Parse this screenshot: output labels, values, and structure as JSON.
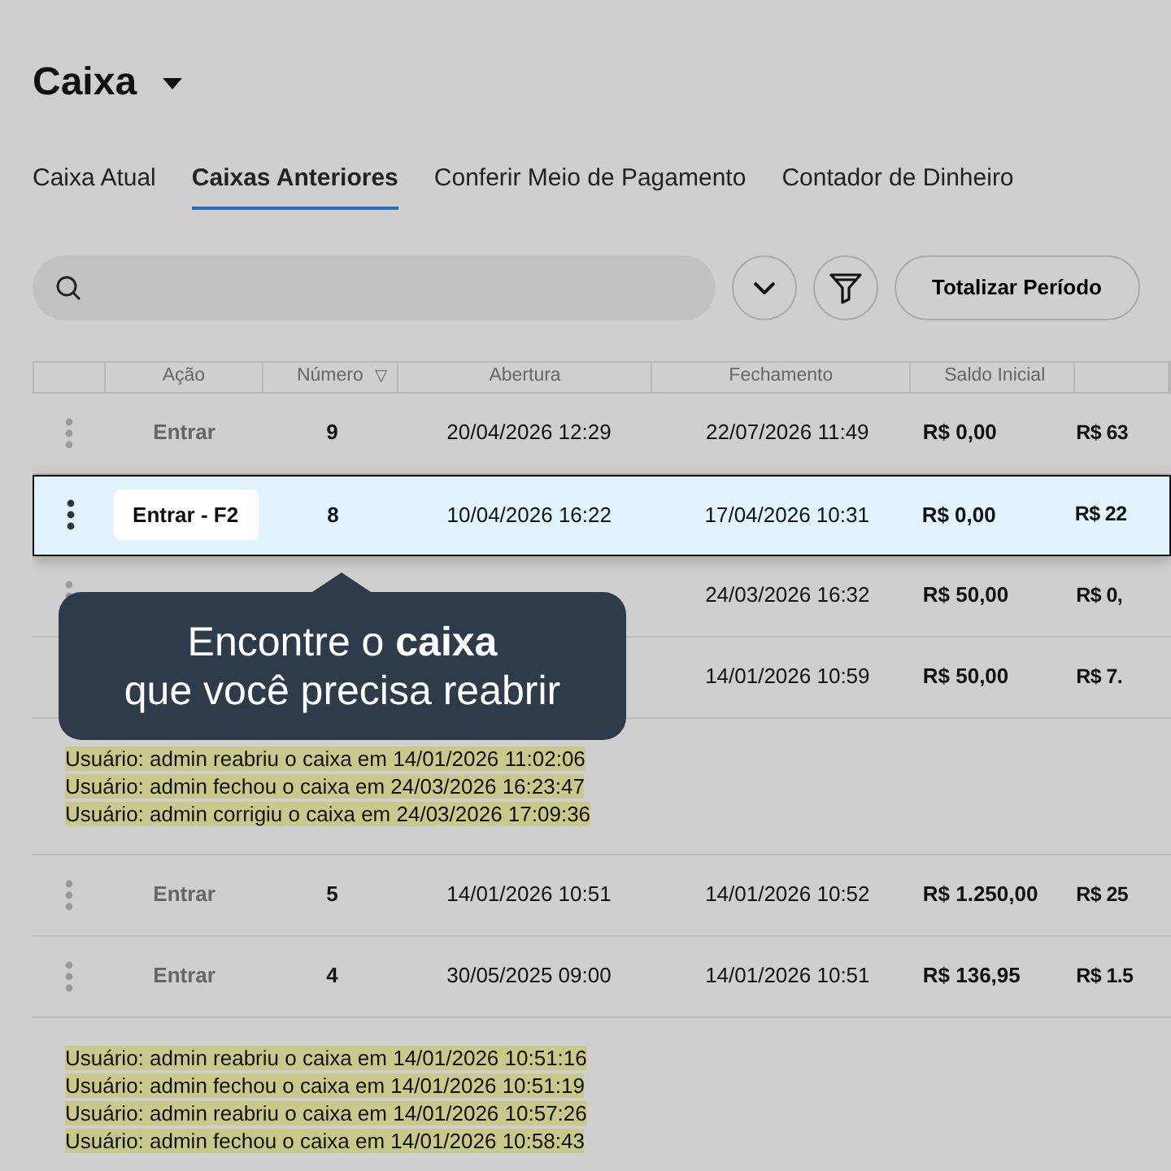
{
  "title": "Caixa",
  "tabs": [
    {
      "label": "Caixa Atual",
      "selected": false
    },
    {
      "label": "Caixas Anteriores",
      "selected": true
    },
    {
      "label": "Conferir Meio de Pagamento",
      "selected": false
    },
    {
      "label": "Contador de Dinheiro",
      "selected": false
    }
  ],
  "toolbar": {
    "button": "Totalizar Período"
  },
  "table": {
    "columns": [
      {},
      {
        "label": "Ação"
      },
      {
        "label": "Número",
        "sort_icon": "▽"
      },
      {
        "label": "Abertura"
      },
      {
        "label": "Fechamento"
      },
      {
        "label": "Saldo Inicial"
      },
      {}
    ],
    "rows": [
      {
        "kind": "row",
        "selected": false,
        "action": "Entrar",
        "number": "9",
        "opening": "20/04/2026 12:29",
        "closing": "22/07/2026 11:49",
        "initial_balance": "R$ 0,00",
        "column_7": "R$ 63"
      },
      {
        "kind": "row",
        "selected": true,
        "action": "Entrar - F2",
        "number": "8",
        "opening": "10/04/2026 16:22",
        "closing": "17/04/2026 10:31",
        "initial_balance": "R$ 0,00",
        "column_7": "R$ 22"
      },
      {
        "kind": "row",
        "selected": false,
        "closing": "24/03/2026 16:32",
        "initial_balance": "R$ 50,00",
        "column_7": "R$ 0,"
      },
      {
        "kind": "row",
        "selected": false,
        "closing": "14/01/2026 10:59",
        "initial_balance": "R$ 50,00",
        "column_7": "R$ 7."
      },
      {
        "kind": "log",
        "lines": [
          "Usuário: admin reabriu o caixa em 14/01/2026 11:02:06",
          "Usuário: admin fechou o caixa em 24/03/2026 16:23:47",
          "Usuário: admin corrigiu o caixa em 24/03/2026 17:09:36"
        ]
      },
      {
        "kind": "row",
        "selected": false,
        "action": "Entrar",
        "number": "5",
        "opening": "14/01/2026 10:51",
        "closing": "14/01/2026 10:52",
        "initial_balance": "R$ 1.250,00",
        "column_7": "R$ 25"
      },
      {
        "kind": "row",
        "selected": false,
        "action": "Entrar",
        "number": "4",
        "opening": "30/05/2025 09:00",
        "closing": "14/01/2026 10:51",
        "initial_balance": "R$ 136,95",
        "column_7": "R$ 1.5"
      },
      {
        "kind": "log",
        "lines": [
          "Usuário: admin reabriu o caixa em 14/01/2026 10:51:16",
          "Usuário: admin fechou o caixa em 14/01/2026 10:51:19",
          "Usuário: admin reabriu o caixa em 14/01/2026 10:57:26",
          "Usuário: admin fechou o caixa em 14/01/2026 10:58:43"
        ]
      }
    ]
  },
  "tooltip": {
    "lines": [
      "Encontre o **caixa**",
      "que você precisa reabrir"
    ]
  }
}
